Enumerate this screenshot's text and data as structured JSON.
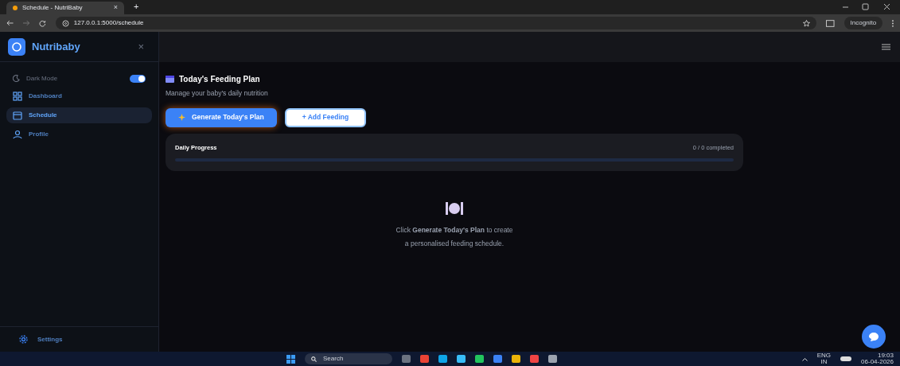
{
  "browser": {
    "tab_title": "Schedule - NutriBaby",
    "tab_close": "×",
    "new_tab": "+",
    "url": "127.0.0.1:5000/schedule",
    "profile": "Incognito"
  },
  "sidebar": {
    "brand": "Nutribaby",
    "close": "×",
    "dark_mode": {
      "label": "Dark Mode",
      "on": true
    },
    "items": [
      {
        "label": "Dashboard",
        "selected": false
      },
      {
        "label": "Schedule",
        "selected": true
      },
      {
        "label": "Profile",
        "selected": false
      }
    ],
    "footer": {
      "label": "Settings"
    }
  },
  "main": {
    "title": "Today's Feeding Plan",
    "subtitle": "Manage your baby's daily nutrition",
    "buttons": [
      {
        "label": "Generate Today's Plan",
        "kind": "primary"
      },
      {
        "label": "+ Add Feeding",
        "kind": "secondary"
      }
    ],
    "progress": {
      "label": "Daily Progress",
      "reading": "0 / 0 completed",
      "level": 0
    },
    "empty_state": {
      "line_1": "Click **Generate Today's Plan** to create",
      "line_2": "a personalised feeding schedule."
    }
  },
  "taskbar": {
    "search": "Search",
    "language": "ENG",
    "region": "IN",
    "time": "19:03",
    "date": "06-04-2026"
  }
}
